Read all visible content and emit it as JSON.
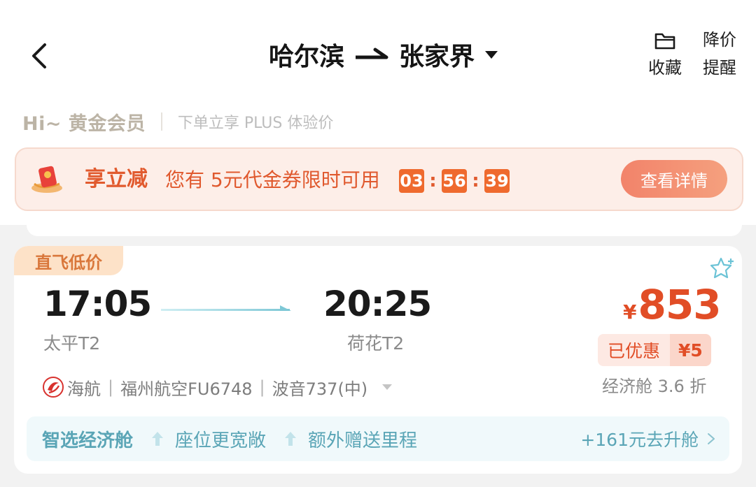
{
  "header": {
    "origin": "哈尔滨",
    "destination": "张家界",
    "favorite_label": "收藏",
    "price_alert_label_1": "降价",
    "price_alert_label_2": "提醒"
  },
  "member": {
    "greeting": "Hi~ 黄金会员",
    "note": "下单立享 PLUS 体验价"
  },
  "coupon": {
    "title": "享立减",
    "message": "您有 5元代金券限时可用",
    "countdown": {
      "hours": "03",
      "minutes": "56",
      "seconds": "39"
    },
    "detail_button": "查看详情"
  },
  "flight": {
    "tag": "直飞低价",
    "departure_time": "17:05",
    "departure_airport": "太平T2",
    "arrival_time": "20:25",
    "arrival_airport": "荷花T2",
    "currency": "¥",
    "price": "853",
    "discount_label": "已优惠",
    "discount_value": "¥5",
    "cabin_discount": "经济舱 3.6 折",
    "airline": "海航",
    "flight_no": "福州航空FU6748",
    "aircraft": "波音737(中)",
    "upgrade": {
      "title": "智选经济舱",
      "feature_1": "座位更宽敞",
      "feature_2": "额外赠送里程",
      "cta": "+161元去升舱"
    }
  },
  "colors": {
    "accent": "#e14d26",
    "coupon_bg": "#fdeee8",
    "upgrade_text": "#5aa5b6"
  }
}
